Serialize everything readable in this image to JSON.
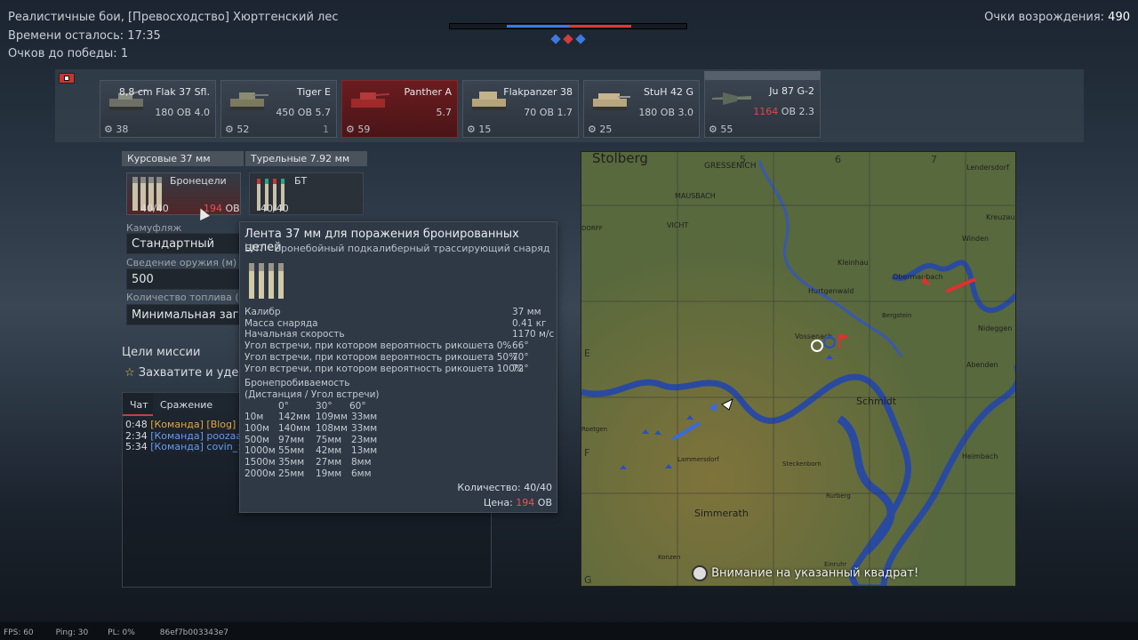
{
  "hud": {
    "mode_title": "Реалистичные бои, [Превосходство] Хюртгенский лес",
    "time_label": "Времени осталось:",
    "time_value": "17:35",
    "points_label": "Очков до победы:",
    "points_value": "1",
    "respawn_label": "Очки возрождения:",
    "respawn_value": "490"
  },
  "vehicles": [
    {
      "name": "8,8 cm Flak 37 Sfl.",
      "br_text": "180 ОВ 4.0",
      "count": "38"
    },
    {
      "name": "Tiger E",
      "br_text": "450 ОВ 5.7",
      "count": "52",
      "extra": "1"
    },
    {
      "name": "Panther A",
      "br_text": "5.7",
      "count": "59"
    },
    {
      "name": "Flakpanzer 38",
      "br_text": "70 ОВ 1.7",
      "count": "15"
    },
    {
      "name": "StuH 42 G",
      "br_text": "180 ОВ 3.0",
      "count": "25"
    },
    {
      "name": "Ju 87 G-2",
      "cost": "1164",
      "br_text": "ОВ 2.3",
      "count": "55"
    }
  ],
  "weapons": {
    "tab1": "Курсовые 37 мм",
    "tab2": "Турельные 7.92 мм",
    "ammo1_name": "Бронецели",
    "ammo1_count": "40/40",
    "ammo1_cost": "194",
    "ammo1_unit": "ОВ",
    "ammo2_name": "БТ",
    "ammo2_count": "40/40"
  },
  "settings": {
    "camo_label": "Камуфляж",
    "camo_value": "Стандартный",
    "conv_label": "Сведение оружия (м)",
    "conv_value": "500",
    "fuel_label": "Количество топлива (ми",
    "fuel_value": "Минимальная загр"
  },
  "mission": {
    "title": "Цели миссии",
    "objective": "Захватите и удер"
  },
  "chat": {
    "tab_chat": "Чат",
    "tab_battle": "Сражение",
    "lines": [
      {
        "time": "0:48",
        "text": "[Команда] [Blog]"
      },
      {
        "time": "2:34",
        "text": "[Команда] poozaa2("
      },
      {
        "time": "5:34",
        "text": "[Команда] covin_: В"
      }
    ]
  },
  "tooltip": {
    "title": "Лента 37 мм для поражения бронированных целей",
    "subtitle": "БПТ - Бронебойный подкалиберный трассирующий снаряд",
    "stats": [
      [
        "Калибр",
        "37 мм"
      ],
      [
        "Масса снаряда",
        "0.41 кг"
      ],
      [
        "Начальная скорость",
        "1170 м/с"
      ],
      [
        "Угол встречи, при котором вероятность рикошета 0%",
        "66°"
      ],
      [
        "Угол встречи, при котором вероятность рикошета 50%",
        "70°"
      ],
      [
        "Угол встречи, при котором вероятность рикошета 100%",
        "72°"
      ]
    ],
    "pen_title": "Бронепробиваемость",
    "pen_sub": "(Дистанция / Угол встречи)",
    "pen_head": [
      "0°",
      "30°",
      "60°"
    ],
    "pen_rows": [
      [
        "10м",
        "142мм",
        "109мм",
        "33мм"
      ],
      [
        "100м",
        "140мм",
        "108мм",
        "33мм"
      ],
      [
        "500м",
        "97мм",
        "75мм",
        "23мм"
      ],
      [
        "1000м",
        "55мм",
        "42мм",
        "13мм"
      ],
      [
        "1500м",
        "35мм",
        "27мм",
        "8мм"
      ],
      [
        "2000м",
        "25мм",
        "19мм",
        "6мм"
      ]
    ],
    "qty_label": "Количество:",
    "qty_value": "40/40",
    "price_label": "Цена:",
    "price_value": "194",
    "price_unit": "ОВ"
  },
  "map": {
    "grid_cols": [
      "5",
      "6",
      "7"
    ],
    "grid_rows": [
      "E",
      "F",
      "G"
    ],
    "places": [
      {
        "t": "Stolberg"
      },
      {
        "t": "GRESSENICH"
      },
      {
        "t": "Lendersdorf"
      },
      {
        "t": "MAUSBACH"
      },
      {
        "t": "VICHT"
      },
      {
        "t": "DORFF"
      },
      {
        "t": "Kreuzau"
      },
      {
        "t": "Winden"
      },
      {
        "t": "Kleinhau"
      },
      {
        "t": "Obermaubach"
      },
      {
        "t": "Hurtgenwald"
      },
      {
        "t": "Bergstein"
      },
      {
        "t": "Nideggen"
      },
      {
        "t": "Vossenack"
      },
      {
        "t": "Abenden"
      },
      {
        "t": "Schmidt"
      },
      {
        "t": "Heimbach"
      },
      {
        "t": "Simmerath"
      },
      {
        "t": "Lammersdorf"
      },
      {
        "t": "Steckenborn"
      },
      {
        "t": "Rurberg"
      },
      {
        "t": "Roetgen"
      },
      {
        "t": "Konzen"
      },
      {
        "t": "Einruhr"
      }
    ],
    "notice": "Внимание на указанный квадрат!"
  },
  "footer": {
    "fps": "FPS: 60",
    "ping": "Ping: 30",
    "pl": "PL: 0%",
    "id": "86ef7b003343e7"
  }
}
